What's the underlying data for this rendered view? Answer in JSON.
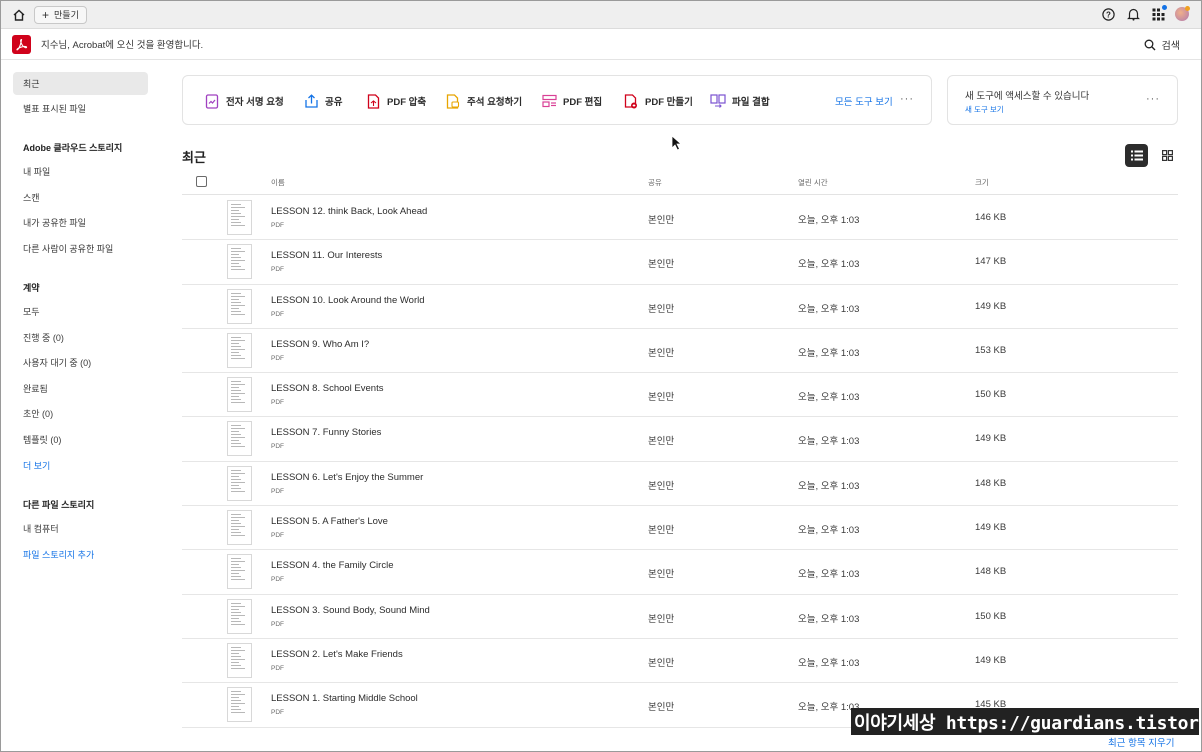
{
  "tabbar": {
    "new_tab_label": "만들기"
  },
  "header": {
    "welcome": "지수님, Acrobat에 오신 것을 환영합니다.",
    "search_label": "검색"
  },
  "sidebar": {
    "recent": "최근",
    "starred": "별표 표시된 파일",
    "cloud_heading": "Adobe 클라우드 스토리지",
    "cloud_items": [
      "내 파일",
      "스캔",
      "내가 공유한 파일",
      "다른 사람이 공유한 파일"
    ],
    "agreements_heading": "계약",
    "agreement_items": [
      "모두",
      "진행 중 (0)",
      "사용자 대기 중 (0)",
      "완료됨",
      "초안 (0)",
      "템플릿 (0)"
    ],
    "more_label": "더 보기",
    "other_heading": "다른 파일 스토리지",
    "other_items": [
      "내 컴퓨터"
    ],
    "add_storage": "파일 스토리지 추가"
  },
  "tools": {
    "items": [
      "전자 서명 요청",
      "공유",
      "PDF 압축",
      "주석 요청하기",
      "PDF 편집",
      "PDF 만들기",
      "파일 결합"
    ],
    "all_tools": "모든 도구 보기",
    "more": "···"
  },
  "promo": {
    "title": "새 도구에 액세스할 수 있습니다",
    "link": "새 도구 보기",
    "more": "···"
  },
  "recent": {
    "title": "최근",
    "columns": {
      "name": "이름",
      "shared": "공유",
      "opened": "열린 시간",
      "size": "크기"
    },
    "files": [
      {
        "name": "LESSON 12. think Back, Look Ahead",
        "type": "PDF",
        "shared": "본인만",
        "opened": "오늘, 오후 1:03",
        "size": "146 KB"
      },
      {
        "name": "LESSON 11. Our Interests",
        "type": "PDF",
        "shared": "본인만",
        "opened": "오늘, 오후 1:03",
        "size": "147 KB"
      },
      {
        "name": "LESSON 10. Look Around the World",
        "type": "PDF",
        "shared": "본인만",
        "opened": "오늘, 오후 1:03",
        "size": "149 KB"
      },
      {
        "name": "LESSON 9. Who Am I?",
        "type": "PDF",
        "shared": "본인만",
        "opened": "오늘, 오후 1:03",
        "size": "153 KB"
      },
      {
        "name": "LESSON 8. School Events",
        "type": "PDF",
        "shared": "본인만",
        "opened": "오늘, 오후 1:03",
        "size": "150 KB"
      },
      {
        "name": "LESSON 7. Funny Stories",
        "type": "PDF",
        "shared": "본인만",
        "opened": "오늘, 오후 1:03",
        "size": "149 KB"
      },
      {
        "name": "LESSON 6. Let's Enjoy the Summer",
        "type": "PDF",
        "shared": "본인만",
        "opened": "오늘, 오후 1:03",
        "size": "148 KB"
      },
      {
        "name": "LESSON 5. A Father's Love",
        "type": "PDF",
        "shared": "본인만",
        "opened": "오늘, 오후 1:03",
        "size": "149 KB"
      },
      {
        "name": "LESSON 4. the Family Circle",
        "type": "PDF",
        "shared": "본인만",
        "opened": "오늘, 오후 1:03",
        "size": "148 KB"
      },
      {
        "name": "LESSON 3. Sound Body, Sound Mind",
        "type": "PDF",
        "shared": "본인만",
        "opened": "오늘, 오후 1:03",
        "size": "150 KB"
      },
      {
        "name": "LESSON 2. Let's Make Friends",
        "type": "PDF",
        "shared": "본인만",
        "opened": "오늘, 오후 1:03",
        "size": "149 KB"
      },
      {
        "name": "LESSON 1. Starting Middle School",
        "type": "PDF",
        "shared": "본인만",
        "opened": "오늘, 오후 1:03",
        "size": "145 KB"
      }
    ],
    "clear_label": "최근 항목 지우기"
  },
  "watermark": "이야기세상 https://guardians.tistory.com",
  "colors": {
    "accent": "#1473e6",
    "brand": "#d0021b"
  }
}
